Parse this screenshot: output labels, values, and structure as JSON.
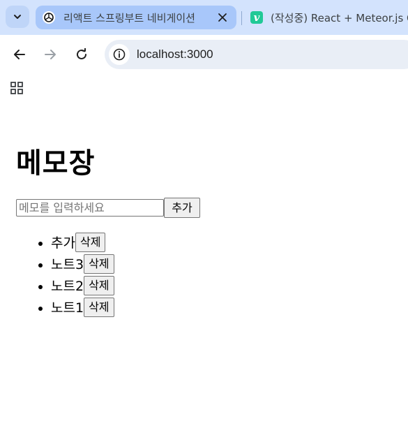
{
  "browser": {
    "tabs": [
      {
        "title": "리액트 스프링부트 네비게이션",
        "icon": "openai-icon",
        "active": true
      },
      {
        "title": "(작성중) React + Meteor.js Cl",
        "icon": "v-icon",
        "active": false
      }
    ],
    "url": "localhost:3000"
  },
  "app": {
    "title": "메모장",
    "input_placeholder": "메모를 입력하세요",
    "add_label": "추가",
    "delete_label": "삭제",
    "memos": [
      "추가",
      "노트3",
      "노트2",
      "노트1"
    ]
  },
  "colors": {
    "tabstrip_bg": "#d3e3fd",
    "active_tab_bg": "#a8c7fa",
    "omnibox_bg": "#e9eef6",
    "vercel_green": "#20c997"
  }
}
